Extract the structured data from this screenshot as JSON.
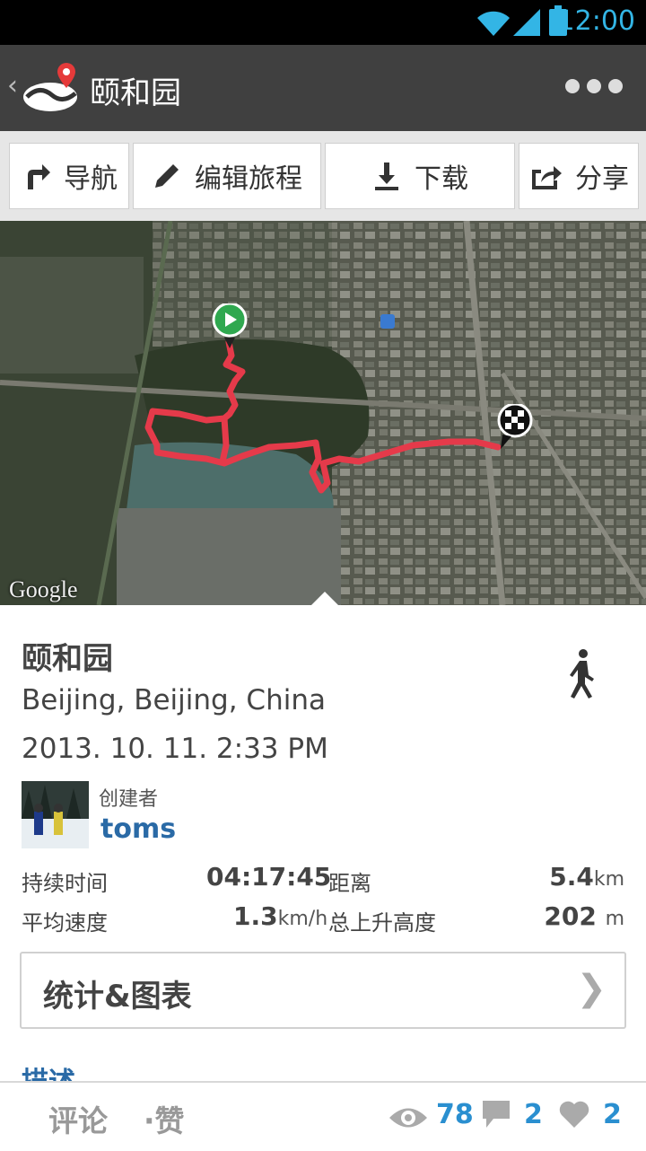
{
  "status_bar": {
    "time": "12:00"
  },
  "action_bar": {
    "back_glyph": "‹",
    "title": "颐和园"
  },
  "toolbar": {
    "navigate_label": "导航",
    "edit_label": "编辑旅程",
    "download_label": "下载",
    "share_label": "分享"
  },
  "map": {
    "attribution": "Google"
  },
  "route": {
    "title": "颐和园",
    "location": "Beijing, Beijing, China",
    "datetime": "2013. 10. 11. 2:33 PM",
    "creator_label": "创建者",
    "creator_name": "toms"
  },
  "stats": {
    "duration_label": "持续时间",
    "duration_value": "04:17:45",
    "distance_label": "距离",
    "distance_value": "5.4",
    "distance_unit": "km",
    "avg_speed_label": "平均速度",
    "avg_speed_value": "1.3",
    "avg_speed_unit": "km/h",
    "ascent_label": "总上升高度",
    "ascent_value": "202",
    "ascent_unit": "m"
  },
  "stats_button": {
    "label": "统计&图表",
    "chevron": "❯"
  },
  "description_link": "描述",
  "bottom_bar": {
    "comment_label": "评论",
    "like_label": "·赞",
    "views_count": "78",
    "comments_count": "2",
    "likes_count": "2"
  },
  "colors": {
    "accent_blue": "#2a8fd0",
    "link_blue": "#2a6aa6",
    "status_blue": "#33b5e5",
    "route_red": "#e53a4a",
    "actionbar_bg": "#404040"
  },
  "icons": [
    "wifi-icon",
    "signal-icon",
    "battery-icon",
    "back-icon",
    "app-logo-icon",
    "overflow-menu-icon",
    "navigate-icon",
    "edit-icon",
    "download-icon",
    "share-icon",
    "start-marker-icon",
    "finish-marker-icon",
    "walk-icon",
    "eye-icon",
    "comment-icon",
    "heart-icon"
  ]
}
